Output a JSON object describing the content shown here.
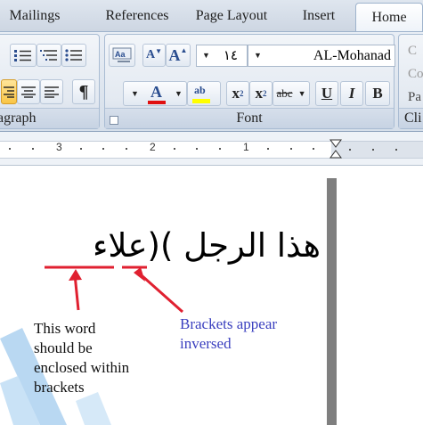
{
  "ribbon_tabs": [
    "Mailings",
    "References",
    "Page Layout",
    "Insert",
    "Home"
  ],
  "active_tab": "Home",
  "groups": {
    "paragraph_label": "agraph",
    "font_label": "Font",
    "clipboard_label": "Cli"
  },
  "font": {
    "size": "١٤",
    "name": "AL-Mohanad",
    "grow_glyph": "A",
    "shrink_glyph": "A",
    "superscript": "x",
    "superscript_mark": "2",
    "subscript": "x",
    "subscript_mark": "2",
    "strike": "abc",
    "underline": "U",
    "italic": "I",
    "bold": "B",
    "font_color_glyph": "A",
    "highlight_glyph": "ab",
    "pilcrow": "¶"
  },
  "clipboard_partial": [
    "C",
    "Co",
    "Pa"
  ],
  "ruler_numbers": [
    "3",
    "2",
    "1"
  ],
  "document": {
    "arabic_text": "هذا الرجل )(علاء",
    "note_left": [
      "This word",
      "should be",
      "enclosed within",
      "brackets"
    ],
    "note_right": [
      "Brackets appear",
      "inversed"
    ]
  },
  "colors": {
    "annotation_red": "#e02030",
    "annotation_blue": "#3a3fbf",
    "font_color_bar": "#e01010",
    "highlight_bar": "#ffff00",
    "page_edge": "#7f7f7f",
    "watermark_blue": "#b9d8f2"
  }
}
